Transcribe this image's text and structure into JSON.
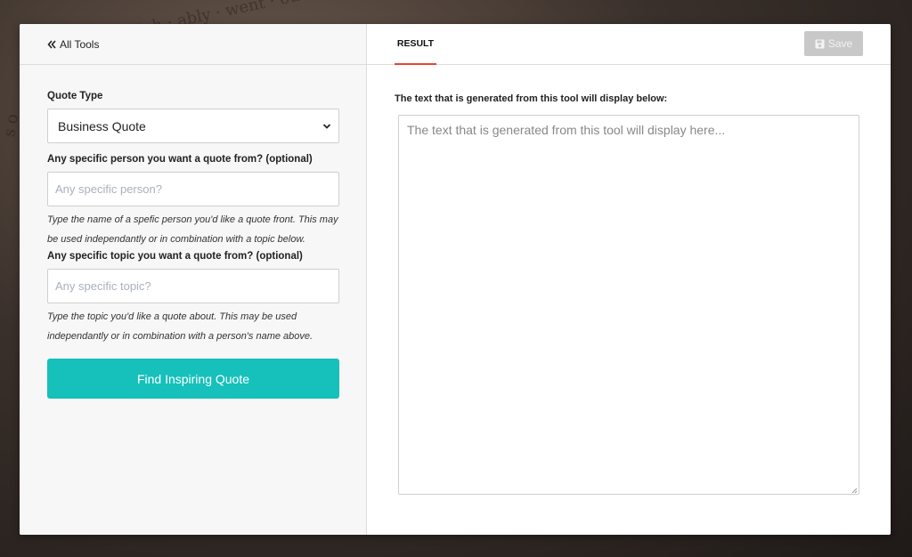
{
  "header": {
    "back_label": "All Tools",
    "tab_result": "RESULT",
    "save_label": "Save"
  },
  "form": {
    "quote_type_label": "Quote Type",
    "quote_type_value": "Business Quote",
    "person_label": "Any specific person you want a quote from? (optional)",
    "person_placeholder": "Any specific person?",
    "person_help": "Type the name of a spefic person you'd like a quote front. This may be used independantly or in combination with a topic below.",
    "topic_label": "Any specific topic you want a quote from? (optional)",
    "topic_placeholder": "Any specific topic?",
    "topic_help": "Type the topic you'd like a quote about. This may be used independantly or in combination with a person's name above.",
    "submit_label": "Find Inspiring Quote"
  },
  "result": {
    "label": "The text that is generated from this tool will display below:",
    "placeholder": "The text that is generated from this tool will display here..."
  },
  "colors": {
    "accent": "#16c0bb",
    "tab_underline": "#e4472e",
    "save_disabled": "#c8c8c8"
  }
}
